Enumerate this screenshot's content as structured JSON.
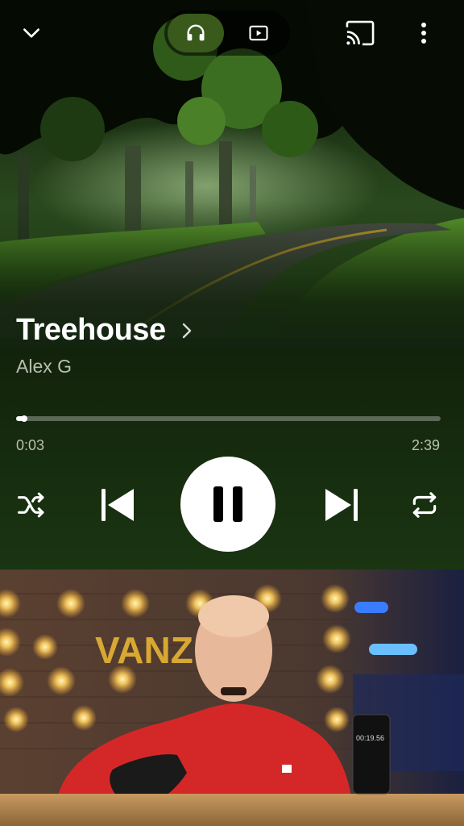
{
  "header": {
    "collapse_icon": "chevron-down-icon",
    "mode_toggle": {
      "audio_icon": "headphones-icon",
      "video_icon": "video-play-icon",
      "active": "audio"
    },
    "cast_icon": "cast-icon",
    "menu_icon": "more-vertical-icon"
  },
  "track": {
    "title": "Treehouse",
    "artist": "Alex G",
    "title_chevron_icon": "chevron-right-icon"
  },
  "progress": {
    "elapsed": "0:03",
    "duration": "2:39",
    "fraction": 0.019
  },
  "controls": {
    "shuffle_icon": "shuffle-icon",
    "previous_icon": "skip-previous-icon",
    "play_state_icon": "pause-icon",
    "next_icon": "skip-next-icon",
    "repeat_icon": "repeat-icon"
  },
  "overlay_video": {
    "sign_text": "VANZ",
    "phone_display": "00:19.56"
  },
  "colors": {
    "accent_toggle": "#3a5a1c",
    "background_dark": "#12220b",
    "text_secondary": "#b8c0b0"
  }
}
